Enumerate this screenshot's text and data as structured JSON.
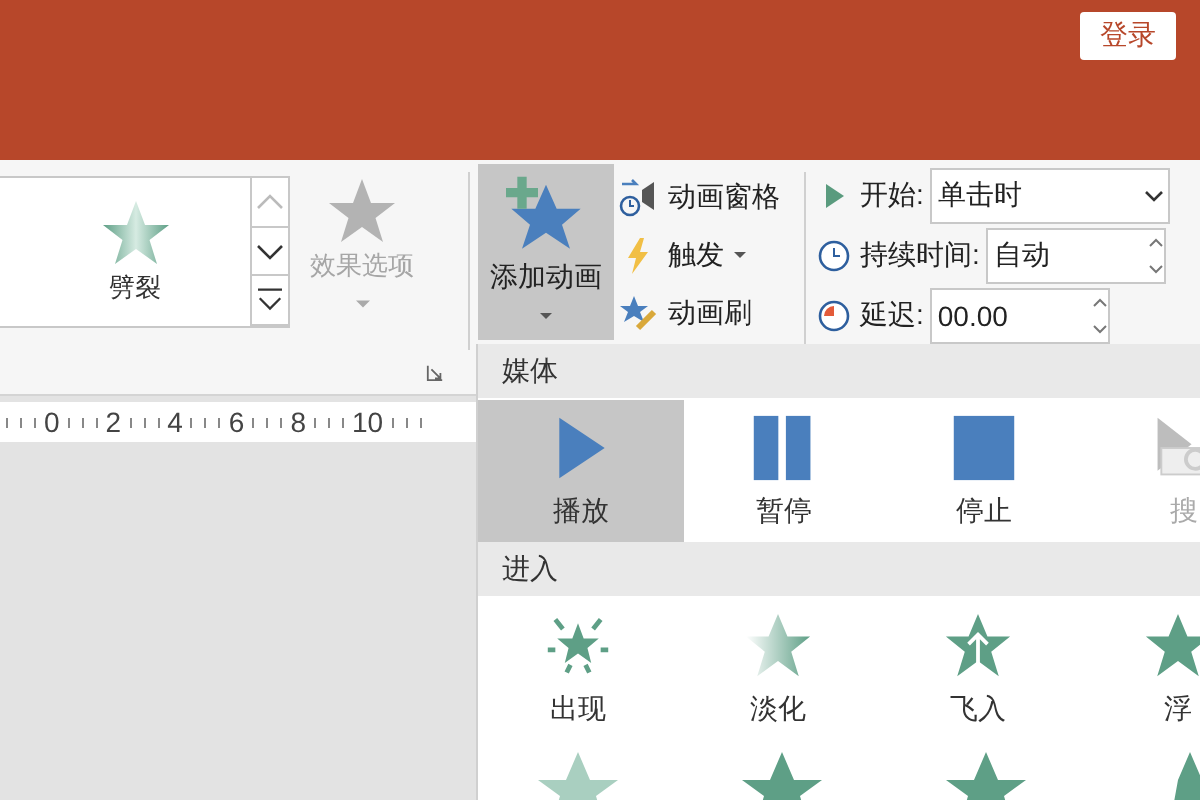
{
  "title_bar": {
    "login_button": "登录"
  },
  "animation_gallery": {
    "item": "劈裂",
    "effect_options": {
      "label": "效果选项",
      "disabled": true
    }
  },
  "add_animation": {
    "label": "添加动画",
    "expanded": true
  },
  "commands": [
    {
      "label": "动画窗格",
      "kind": "pane",
      "dropdown": false
    },
    {
      "label": "触发",
      "kind": "trigger",
      "dropdown": true
    },
    {
      "label": "动画刷",
      "kind": "painter",
      "dropdown": false
    }
  ],
  "timing": [
    {
      "label": "开始:",
      "value": "单击时",
      "kind": "dropdown"
    },
    {
      "label": "持续时间:",
      "value": "自动",
      "kind": "spinner"
    },
    {
      "label": "延迟:",
      "value": "00.00",
      "kind": "spinner"
    }
  ],
  "ruler": {
    "ticks": [
      "0",
      "2",
      "4",
      "6",
      "8",
      "10"
    ]
  },
  "menu": {
    "sections": [
      {
        "title": "媒体",
        "items": [
          {
            "label": "播放",
            "kind": "play",
            "selected": true,
            "disabled": false
          },
          {
            "label": "暂停",
            "kind": "pause",
            "selected": false,
            "disabled": false
          },
          {
            "label": "停止",
            "kind": "stop",
            "selected": false,
            "disabled": false
          },
          {
            "label": "搜",
            "kind": "seek",
            "selected": false,
            "disabled": true
          }
        ]
      },
      {
        "title": "进入",
        "items": [
          {
            "label": "出现",
            "kind": "appear",
            "selected": false,
            "disabled": false
          },
          {
            "label": "淡化",
            "kind": "fade",
            "selected": false,
            "disabled": false
          },
          {
            "label": "飞入",
            "kind": "fly",
            "selected": false,
            "disabled": false
          },
          {
            "label": "浮",
            "kind": "float",
            "selected": false,
            "disabled": false
          }
        ]
      }
    ]
  }
}
